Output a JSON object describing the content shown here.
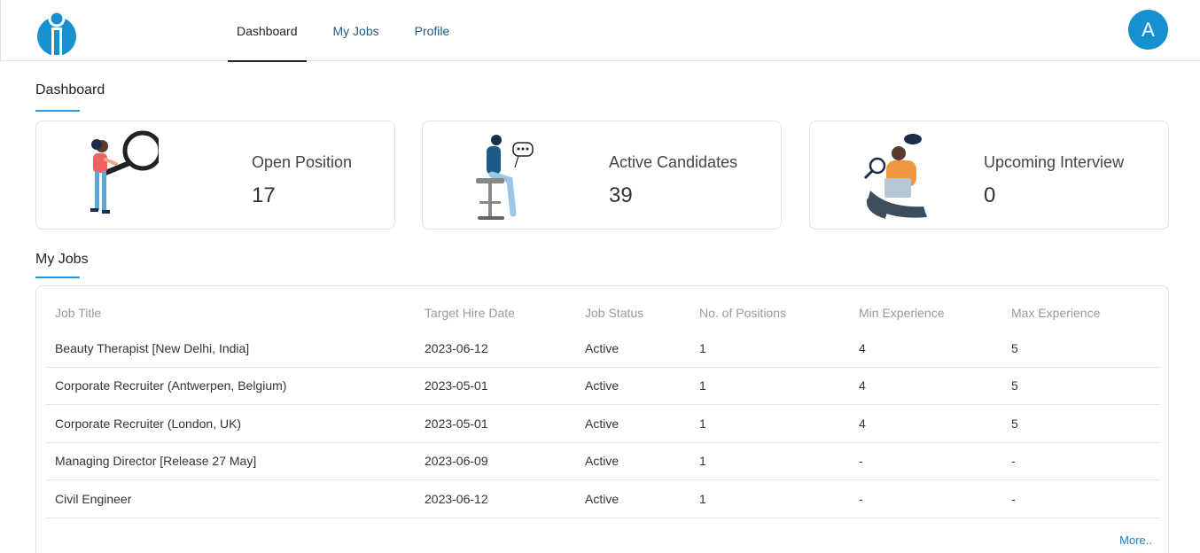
{
  "nav": {
    "tabs": [
      {
        "label": "Dashboard",
        "active": true
      },
      {
        "label": "My Jobs",
        "active": false
      },
      {
        "label": "Profile",
        "active": false
      }
    ],
    "avatar_letter": "A"
  },
  "dashboard": {
    "title": "Dashboard",
    "cards": [
      {
        "label": "Open Position",
        "value": "17",
        "illustration": "magnifier-person-icon"
      },
      {
        "label": "Active Candidates",
        "value": "39",
        "illustration": "person-on-stool-chat-icon"
      },
      {
        "label": "Upcoming Interview",
        "value": "0",
        "illustration": "person-with-laptop-icon"
      }
    ]
  },
  "jobs": {
    "title": "My Jobs",
    "columns": [
      "Job Title",
      "Target Hire Date",
      "Job Status",
      "No. of Positions",
      "Min Experience",
      "Max Experience"
    ],
    "rows": [
      [
        "Beauty Therapist [New Delhi, India]",
        "2023-06-12",
        "Active",
        "1",
        "4",
        "5"
      ],
      [
        "Corporate Recruiter (Antwerpen, Belgium)",
        "2023-05-01",
        "Active",
        "1",
        "4",
        "5"
      ],
      [
        "Corporate Recruiter (London, UK)",
        "2023-05-01",
        "Active",
        "1",
        "4",
        "5"
      ],
      [
        "Managing Director [Release 27 May]",
        "2023-06-09",
        "Active",
        "1",
        "-",
        "-"
      ],
      [
        "Civil Engineer",
        "2023-06-12",
        "Active",
        "1",
        "-",
        "-"
      ]
    ],
    "more_label": "More.."
  },
  "colors": {
    "accent": "#1690cf",
    "link": "#1e5a85",
    "underline": "#2a9ad8"
  }
}
